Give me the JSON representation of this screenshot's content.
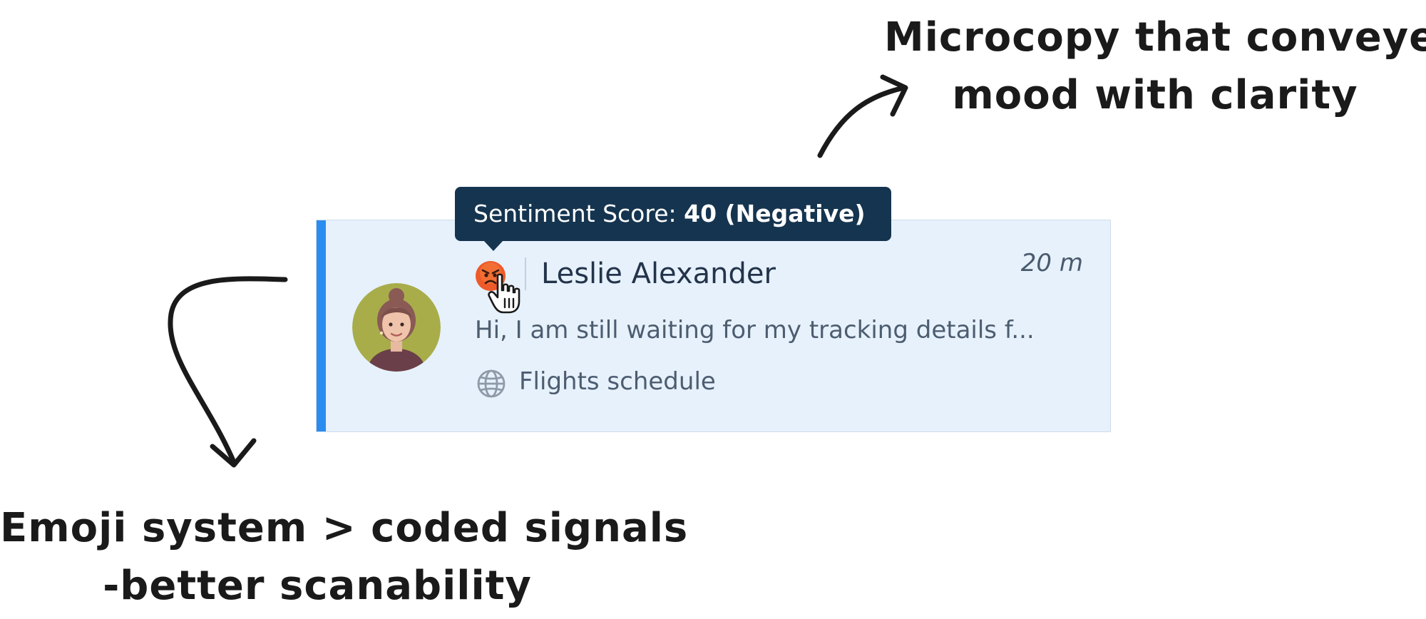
{
  "annotations": {
    "top_line1": "Microcopy that conveyed",
    "top_line2": "mood with clarity",
    "bottom_line1": "Emoji system > coded signals",
    "bottom_line2": "-better scanability"
  },
  "conversation": {
    "contact_name": "Leslie Alexander",
    "time_ago": "20 m",
    "message_preview": "Hi, I am still waiting for my tracking details f...",
    "channel": "Flights schedule",
    "sentiment_emoji": "angry-face",
    "accent_color": "#2b8cf0"
  },
  "tooltip": {
    "label": "Sentiment Score: ",
    "value": "40 (Negative)"
  },
  "icons": {
    "avatar": "avatar",
    "sentiment": "angry-face-icon",
    "cursor": "hand-pointer-icon",
    "channel": "globe-icon"
  }
}
